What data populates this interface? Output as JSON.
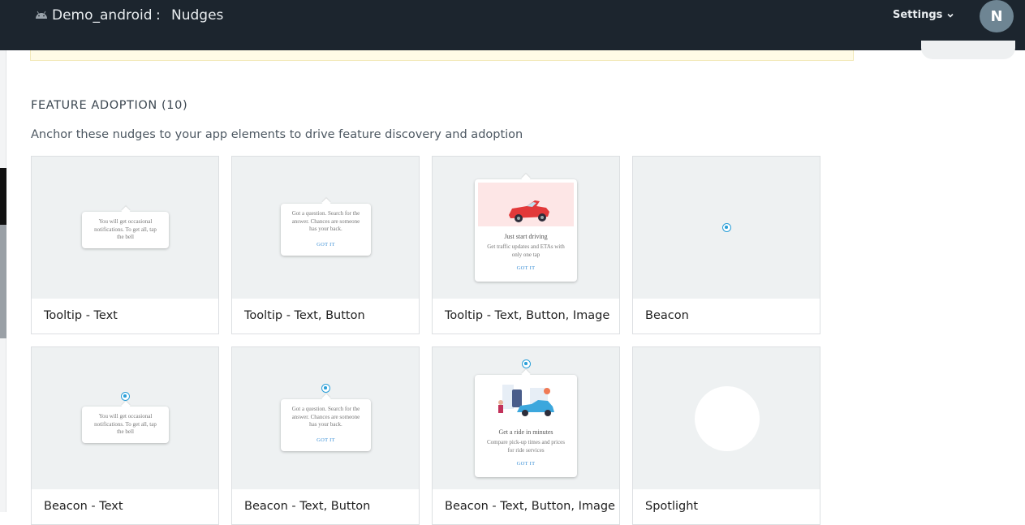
{
  "header": {
    "app_name": "Demo_android",
    "separator": ":",
    "page_title": "Nudges",
    "settings_label": "Settings",
    "avatar_initial": "N"
  },
  "section": {
    "title": "FEATURE ADOPTION (10)",
    "description": "Anchor these nudges to your app elements to drive feature discovery and adoption"
  },
  "cards": [
    {
      "label": "Tooltip - Text",
      "tip_text": "You will get occasional notifications. To get all, tap the bell"
    },
    {
      "label": "Tooltip - Text, Button",
      "tip_text": "Got a question. Search for the answer. Chances are someone has your back.",
      "button": "GOT IT"
    },
    {
      "label": "Tooltip - Text, Button, Image",
      "tip_title": "Just start driving",
      "tip_text": "Get traffic updates and ETAs with only one tap",
      "button": "GOT IT"
    },
    {
      "label": "Beacon"
    },
    {
      "label": "Beacon - Text",
      "tip_text": "You will get occasional notifications. To get all, tap the bell"
    },
    {
      "label": "Beacon - Text, Button",
      "tip_text": "Got a question. Search for the answer. Chances are someone has your back.",
      "button": "GOT IT"
    },
    {
      "label": "Beacon - Text, Button, Image",
      "tip_title": "Get a ride in minutes",
      "tip_text": "Compare pick-up times and prices for ride services",
      "button": "GOT IT"
    },
    {
      "label": "Spotlight"
    }
  ],
  "colors": {
    "topbar": "#1c252e",
    "beacon": "#2a9fd8",
    "preview_bg": "#eef1f2",
    "avatar": "#6e8593"
  }
}
